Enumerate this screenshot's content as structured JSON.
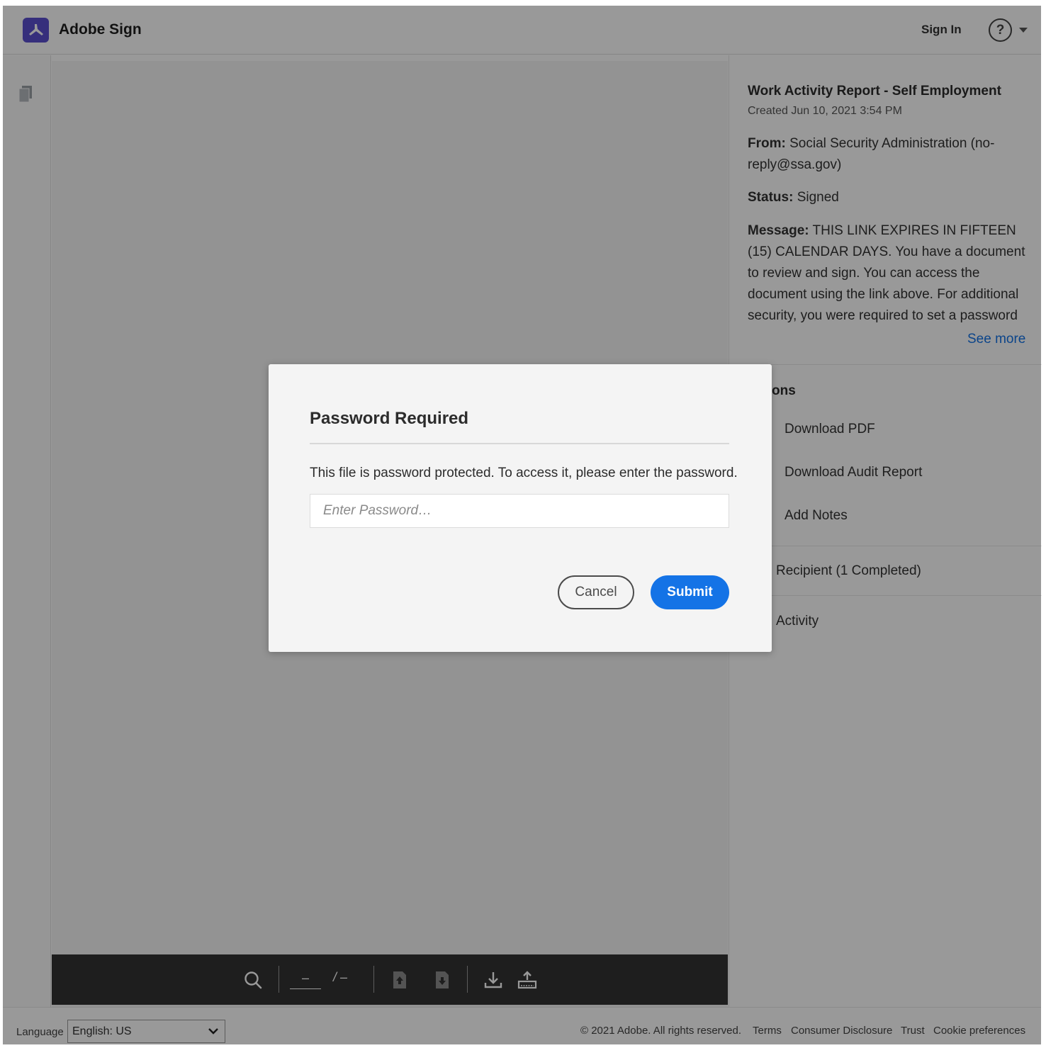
{
  "header": {
    "app_title": "Adobe Sign",
    "sign_in": "Sign In",
    "help_glyph": "?",
    "icons": [
      "adobe-sign-logo-icon",
      "help-icon",
      "chevron-down-icon"
    ]
  },
  "left_rail": {
    "icons": [
      "pages-icon"
    ]
  },
  "toolbar": {
    "page_current": "–",
    "page_total": "/ –",
    "icons": [
      "search-icon",
      "previous-page-icon",
      "next-page-icon",
      "download-icon",
      "upload-icon"
    ]
  },
  "agreement": {
    "title": "Work Activity Report - Self Employment",
    "created": "Created Jun 10, 2021 3:54 PM",
    "from_label": "From:",
    "from_value": "Social Security Administration (no-reply@ssa.gov)",
    "status_label": "Status:",
    "status_value": "Signed",
    "message_label": "Message:",
    "message_value": "THIS LINK EXPIRES IN FIFTEEN (15) CALENDAR DAYS. You have a document to review and sign. You can access the document using the link above. For additional security, you were required to set a password",
    "see_more": "See more"
  },
  "actions": {
    "section_title": "ons",
    "items": [
      {
        "label": "Download PDF"
      },
      {
        "label": "Download Audit Report"
      },
      {
        "label": "Add Notes"
      }
    ]
  },
  "recipient": {
    "label": "Recipient (1 Completed)"
  },
  "activity": {
    "label": "Activity"
  },
  "footer": {
    "language_label": "Language",
    "language_value": "English: US",
    "copyright": "© 2021 Adobe. All rights reserved.",
    "links": [
      "Terms",
      "Consumer Disclosure",
      "Trust",
      "Cookie preferences"
    ]
  },
  "modal": {
    "title": "Password Required",
    "message": "This file is password protected. To access it, please enter the password.",
    "password_placeholder": "Enter Password…",
    "password_value": "",
    "cancel_label": "Cancel",
    "submit_label": "Submit"
  },
  "colors": {
    "accent": "#1473e6",
    "logo": "#5a4fcf",
    "toolbar": "#323232",
    "overlay": "rgba(0,0,0,0.40)"
  }
}
